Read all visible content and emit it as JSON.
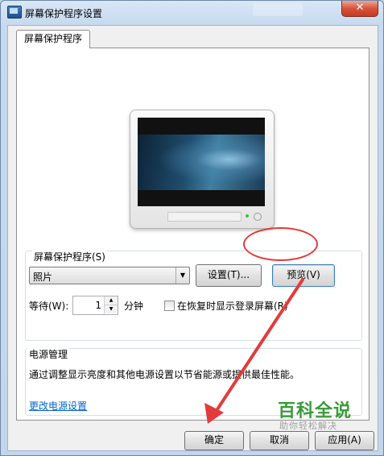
{
  "window": {
    "title": "屏幕保护程序设置",
    "close_label": "✕"
  },
  "tabs": [
    {
      "label": "屏幕保护程序"
    }
  ],
  "screensaver": {
    "group_label": "屏幕保护程序(S)",
    "selected": "照片",
    "settings_button": "设置(T)...",
    "preview_button": "预览(V)",
    "wait_label": "等待(W):",
    "wait_value": "1",
    "wait_unit": "分钟",
    "resume_logon_label": "在恢复时显示登录屏幕(R)",
    "resume_logon_checked": false
  },
  "power": {
    "group_label": "电源管理",
    "description": "通过调整显示亮度和其他电源设置以节省能源或提供最佳性能。",
    "link": "更改电源设置"
  },
  "footer": {
    "ok": "确定",
    "cancel": "取消",
    "apply": "应用(A)"
  },
  "watermark": {
    "title": "百科全说",
    "subtitle": "助你轻松解决"
  },
  "colors": {
    "annotation_red": "#e23b3b",
    "link_blue": "#0066cc",
    "watermark_green": "#3a9a3a"
  }
}
